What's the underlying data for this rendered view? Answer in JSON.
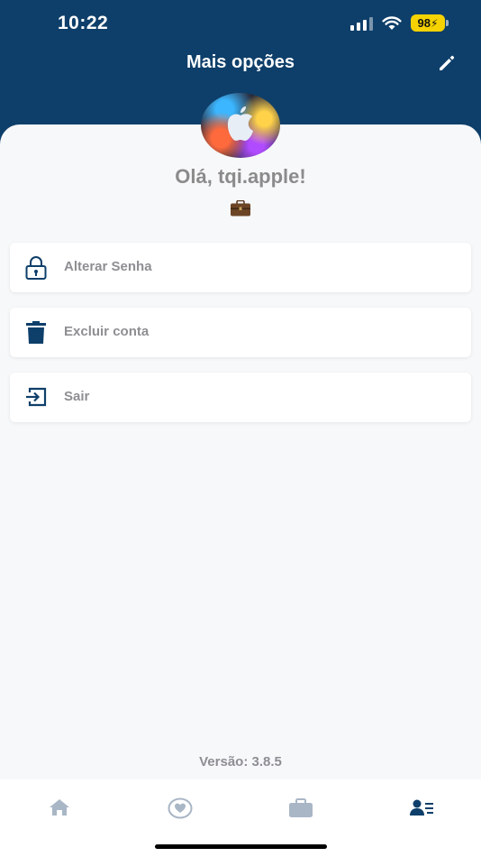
{
  "status_bar": {
    "time": "10:22",
    "battery": "98"
  },
  "header": {
    "title": "Mais opções",
    "edit_icon": "pencil-icon",
    "background_color": "#0e3f6a"
  },
  "profile": {
    "greeting": "Olá, tqi.apple!",
    "badge_emoji": "💼"
  },
  "options": [
    {
      "label": "Alterar Senha",
      "icon": "lock-icon"
    },
    {
      "label": "Excluir conta",
      "icon": "trash-icon"
    },
    {
      "label": "Sair",
      "icon": "logout-icon"
    }
  ],
  "footer": {
    "version": "Versão: 3.8.5"
  },
  "tabbar": {
    "tabs": [
      {
        "icon": "home-icon",
        "active": false
      },
      {
        "icon": "heart-icon",
        "active": false
      },
      {
        "icon": "briefcase-icon",
        "active": false
      },
      {
        "icon": "user-list-icon",
        "active": true
      }
    ],
    "active_color": "#0e3f6a",
    "inactive_color": "#a9b6c6"
  }
}
